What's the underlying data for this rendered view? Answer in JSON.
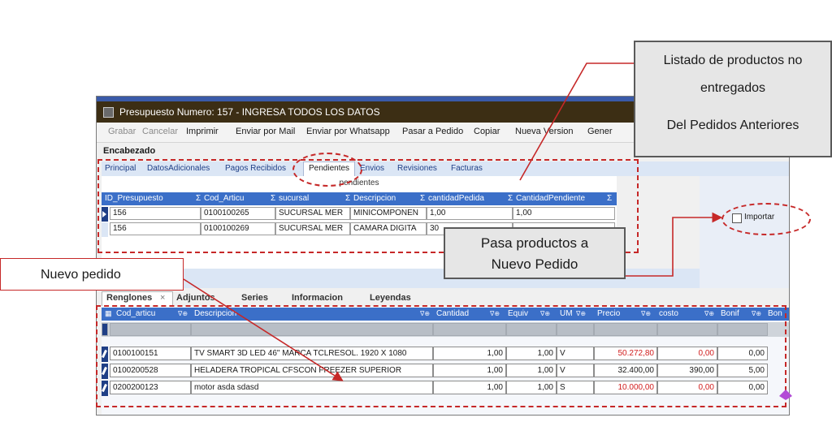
{
  "window": {
    "title": "Presupuesto Numero: 157 - INGRESA TODOS LOS DATOS",
    "toolbar": [
      "Grabar",
      "Cancelar",
      "Imprimir",
      "Enviar por Mail",
      "Enviar por Whatsapp",
      "Pasar a Pedido",
      "Copiar",
      "Nueva Version",
      "Gener"
    ],
    "section_label": "Encabezado",
    "tabs": [
      "Principal",
      "DatosAdicionales",
      "Pagos Recibidos",
      "Pendientes",
      "Envios",
      "Revisiones",
      "Facturas"
    ],
    "active_tab": "Pendientes"
  },
  "pendientes": {
    "caption": "pendientes",
    "columns": [
      "ID_Presupuesto",
      "Cod_Articu",
      "sucursal",
      "Descripcion",
      "cantidadPedida",
      "CantidadPendiente"
    ],
    "sum_marker": "Σ",
    "rows": [
      [
        "156",
        "0100100265",
        "SUCURSAL MER",
        "MINICOMPONEN",
        "1,00",
        "1,00"
      ],
      [
        "156",
        "0100100269",
        "SUCURSAL MER",
        "CAMARA DIGITA",
        "30",
        ""
      ]
    ]
  },
  "import": {
    "label": "Importar",
    "checked": false
  },
  "bottom_tabs": [
    "Renglones",
    "Adjuntos",
    "Series",
    "Informacion",
    "Leyendas"
  ],
  "bottom_tab_close": "×",
  "renglones": {
    "columns": [
      "Cod_articu",
      "Descripcion",
      "Cantidad",
      "Equiv",
      "UM",
      "Precio",
      "costo",
      "Bonif",
      "Bon"
    ],
    "filter_glyph": "∇⊕",
    "rows": [
      [
        "0100100151",
        "TV SMART 3D LED 46\" MARCA TCLRESOL. 1920 X 1080",
        "1,00",
        "1,00",
        "V",
        "50.272,80",
        "0,00",
        "0,00"
      ],
      [
        "0100200528",
        "HELADERA TROPICAL CFSCON FREEZER SUPERIOR",
        "1,00",
        "1,00",
        "V",
        "32.400,00",
        "390,00",
        "5,00"
      ],
      [
        "0200200123",
        "motor  asda sdasd",
        "1,00",
        "1,00",
        "S",
        "10.000,00",
        "0,00",
        "0,00"
      ]
    ],
    "red_values": [
      "50.272,80",
      "0,00",
      "10.000,00"
    ]
  },
  "annotations": {
    "listado_line1": "Listado de productos no",
    "listado_line2": "entregados",
    "listado_line3": "Del Pedidos Anteriores",
    "pasa_line1": "Pasa productos a",
    "pasa_line2": "Nuevo Pedido",
    "nuevo_pedido": "Nuevo pedido"
  },
  "colors": {
    "accent_red": "#c62828",
    "grid_header": "#3b6fc8",
    "title_bar": "#3c2e14",
    "price_red": "#d11d1d"
  }
}
